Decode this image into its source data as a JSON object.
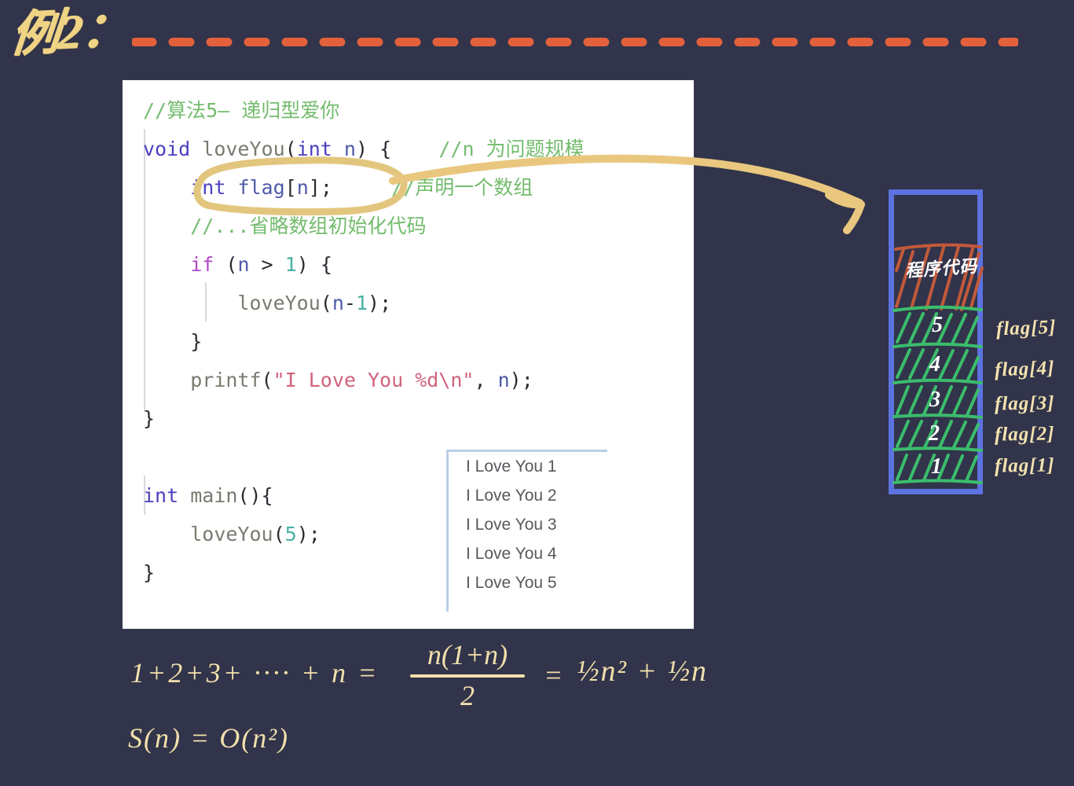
{
  "page": {
    "background_color": "#31344a",
    "accent_yellow": "#f0d486",
    "accent_orange": "#e2613c",
    "accent_blue": "#5b72e0",
    "hatch_green": "#3bbd6c",
    "hatch_orange": "#c2593a"
  },
  "header": {
    "title": "例2：",
    "divider": "dashed-line"
  },
  "code_card": {
    "lines": [
      {
        "indent": 0,
        "tokens": [
          {
            "t": "//算法5— 递归型爱你",
            "c": "cmt"
          }
        ]
      },
      {
        "indent": 0,
        "tokens": [
          {
            "t": "void",
            "c": "kw"
          },
          {
            "t": " ",
            "c": "pnc"
          },
          {
            "t": "loveYou",
            "c": "fn"
          },
          {
            "t": "(",
            "c": "pnc"
          },
          {
            "t": "int",
            "c": "kw"
          },
          {
            "t": " n",
            "c": "vr"
          },
          {
            "t": ") {",
            "c": "pnc"
          },
          {
            "t": "    ",
            "c": "pnc"
          },
          {
            "t": "//n 为问题规模",
            "c": "cmt"
          }
        ]
      },
      {
        "indent": 1,
        "tokens": [
          {
            "t": "int",
            "c": "kw"
          },
          {
            "t": " ",
            "c": "pnc"
          },
          {
            "t": "flag",
            "c": "vr"
          },
          {
            "t": "[",
            "c": "pnc"
          },
          {
            "t": "n",
            "c": "vr"
          },
          {
            "t": "];",
            "c": "pnc"
          },
          {
            "t": "     ",
            "c": "pnc"
          },
          {
            "t": "//声明一个数组",
            "c": "cmt"
          }
        ]
      },
      {
        "indent": 1,
        "tokens": [
          {
            "t": "//...省略数组初始化代码",
            "c": "cmt"
          }
        ]
      },
      {
        "indent": 1,
        "tokens": [
          {
            "t": "if",
            "c": "kw2"
          },
          {
            "t": " (",
            "c": "pnc"
          },
          {
            "t": "n",
            "c": "vr"
          },
          {
            "t": " > ",
            "c": "pnc"
          },
          {
            "t": "1",
            "c": "num"
          },
          {
            "t": ") {",
            "c": "pnc"
          }
        ]
      },
      {
        "indent": 2,
        "tokens": [
          {
            "t": "loveYou",
            "c": "fn"
          },
          {
            "t": "(",
            "c": "pnc"
          },
          {
            "t": "n",
            "c": "vr"
          },
          {
            "t": "-",
            "c": "pnc"
          },
          {
            "t": "1",
            "c": "num"
          },
          {
            "t": ");",
            "c": "pnc"
          }
        ]
      },
      {
        "indent": 1,
        "tokens": [
          {
            "t": "}",
            "c": "pnc"
          }
        ]
      },
      {
        "indent": 1,
        "tokens": [
          {
            "t": "printf",
            "c": "fn"
          },
          {
            "t": "(",
            "c": "pnc"
          },
          {
            "t": "\"I Love You %d\\n\"",
            "c": "str"
          },
          {
            "t": ", ",
            "c": "pnc"
          },
          {
            "t": "n",
            "c": "vr"
          },
          {
            "t": ");",
            "c": "pnc"
          }
        ]
      },
      {
        "indent": 0,
        "tokens": [
          {
            "t": "}",
            "c": "pnc"
          }
        ]
      },
      {
        "indent": 0,
        "tokens": [
          {
            "t": " ",
            "c": "pnc"
          }
        ]
      },
      {
        "indent": 0,
        "tokens": [
          {
            "t": "int",
            "c": "kw"
          },
          {
            "t": " ",
            "c": "pnc"
          },
          {
            "t": "main",
            "c": "fn"
          },
          {
            "t": "(){",
            "c": "pnc"
          }
        ]
      },
      {
        "indent": 1,
        "tokens": [
          {
            "t": "loveYou",
            "c": "fn"
          },
          {
            "t": "(",
            "c": "pnc"
          },
          {
            "t": "5",
            "c": "num"
          },
          {
            "t": ");",
            "c": "pnc"
          }
        ]
      },
      {
        "indent": 0,
        "tokens": [
          {
            "t": "}",
            "c": "pnc"
          }
        ]
      }
    ],
    "output_panel": {
      "lines": [
        "I Love You 1",
        "I Love You 2",
        "I Love You 3",
        "I Love You 4",
        "I Love You 5"
      ]
    },
    "annotation": {
      "circled_statement": "int flag[n];",
      "arrow": "curved-arrow-to-memory"
    }
  },
  "memory_diagram": {
    "code_region_label": "程序代码",
    "stack_frames": [
      {
        "number": "5",
        "label": "flag[5]"
      },
      {
        "number": "4",
        "label": "flag[4]"
      },
      {
        "number": "3",
        "label": "flag[3]"
      },
      {
        "number": "2",
        "label": "flag[2]"
      },
      {
        "number": "1",
        "label": "flag[1]"
      }
    ]
  },
  "formulas": {
    "sum_lhs": "1+2+3+ ···· + n =",
    "fraction_numerator": "n(1+n)",
    "fraction_denominator": "2",
    "equals": "=",
    "half_n2": "n",
    "sum_rhs": "½n² + ½n",
    "space_complexity": "S(n) = O(n²)"
  }
}
